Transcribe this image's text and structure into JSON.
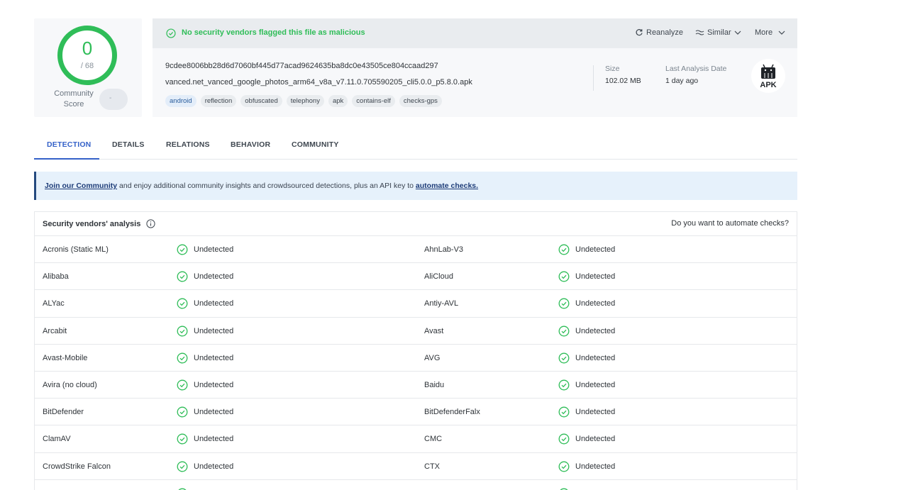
{
  "score": {
    "value": "0",
    "total": "/ 68",
    "community_label": "Community Score",
    "community_value": "-"
  },
  "banner": {
    "message": "No security vendors flagged this file as malicious"
  },
  "actions": {
    "reanalyze": "Reanalyze",
    "similar": "Similar",
    "more": "More"
  },
  "file": {
    "hash": "9cdee8006bb28d6d7060bf445d77acad9624635ba8dc0e43505ce804ccaad297",
    "name": "vanced.net_vanced_google_photos_arm64_v8a_v7.11.0.705590205_cli5.0.0_p5.8.0.apk",
    "tags": [
      "android",
      "reflection",
      "obfuscated",
      "telephony",
      "apk",
      "contains-elf",
      "checks-gps"
    ]
  },
  "meta": {
    "size_label": "Size",
    "size_value": "102.02 MB",
    "date_label": "Last Analysis Date",
    "date_value": "1 day ago",
    "type_badge": "APK"
  },
  "tabs": [
    "DETECTION",
    "DETAILS",
    "RELATIONS",
    "BEHAVIOR",
    "COMMUNITY"
  ],
  "notice": {
    "link1": "Join our Community",
    "middle": " and enjoy additional community insights and crowdsourced detections, plus an API key to ",
    "link2": "automate checks."
  },
  "vendors": {
    "title": "Security vendors' analysis",
    "automate": "Do you want to automate checks?",
    "status_label": "Undetected",
    "rows": [
      [
        "Acronis (Static ML)",
        "AhnLab-V3"
      ],
      [
        "Alibaba",
        "AliCloud"
      ],
      [
        "ALYac",
        "Antiy-AVL"
      ],
      [
        "Arcabit",
        "Avast"
      ],
      [
        "Avast-Mobile",
        "AVG"
      ],
      [
        "Avira (no cloud)",
        "Baidu"
      ],
      [
        "BitDefender",
        "BitDefenderFalx"
      ],
      [
        "ClamAV",
        "CMC"
      ],
      [
        "CrowdStrike Falcon",
        "CTX"
      ]
    ]
  },
  "colors": {
    "green": "#2fbd58",
    "blue": "#3461c8",
    "navy": "#1d3c78"
  }
}
